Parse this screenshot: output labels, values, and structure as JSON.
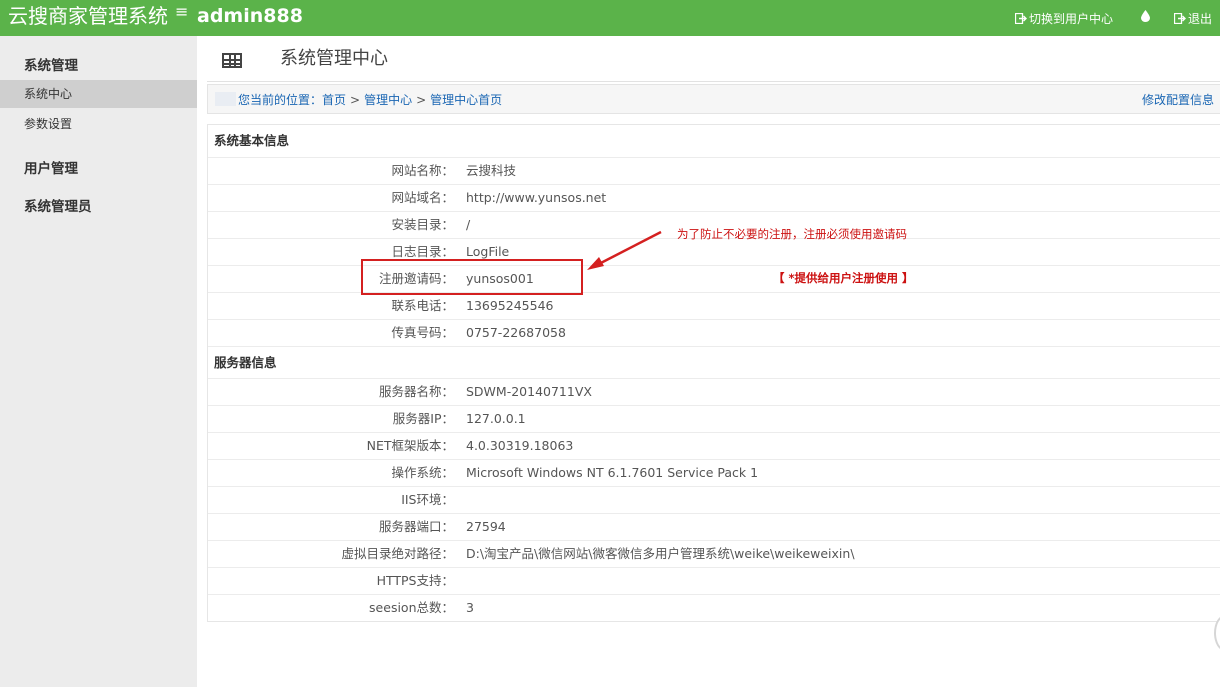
{
  "header": {
    "brand": "云搜商家管理系统",
    "menu_icon": "≡",
    "username": "admin888",
    "switch_label": "切换到用户中心",
    "logout_label": "退出"
  },
  "sidebar": {
    "groups": [
      {
        "label": "系统管理"
      },
      {
        "label": "用户管理"
      },
      {
        "label": "系统管理员"
      }
    ],
    "items": [
      {
        "label": "系统中心",
        "active": true
      },
      {
        "label": "参数设置",
        "active": false
      }
    ]
  },
  "page": {
    "title": "系统管理中心",
    "breadcrumb": {
      "prefix": "您当前的位置：",
      "items": [
        "首页",
        "管理中心",
        "管理中心首页"
      ],
      "separator": ">"
    },
    "config_link": "修改配置信息"
  },
  "basic_info": {
    "title": "系统基本信息",
    "rows": [
      {
        "key": "网站名称：",
        "value": "云搜科技"
      },
      {
        "key": "网站域名：",
        "value": "http://www.yunsos.net"
      },
      {
        "key": "安装目录：",
        "value": "/"
      },
      {
        "key": "日志目录：",
        "value": "LogFile"
      },
      {
        "key": "注册邀请码：",
        "value": "yunsos001"
      },
      {
        "key": "联系电话：",
        "value": "13695245546"
      },
      {
        "key": "传真号码：",
        "value": "0757-22687058"
      }
    ]
  },
  "server_info": {
    "title": "服务器信息",
    "rows": [
      {
        "key": "服务器名称：",
        "value": "SDWM-20140711VX"
      },
      {
        "key": "服务器IP：",
        "value": "127.0.0.1"
      },
      {
        "key": "NET框架版本：",
        "value": "4.0.30319.18063"
      },
      {
        "key": "操作系统：",
        "value": "Microsoft Windows NT 6.1.7601 Service Pack 1"
      },
      {
        "key": "IIS环境：",
        "value": ""
      },
      {
        "key": "服务器端口：",
        "value": "27594"
      },
      {
        "key": "虚拟目录绝对路径：",
        "value": "D:\\淘宝产品\\微信网站\\微客微信多用户管理系统\\weike\\weikeweixin\\"
      },
      {
        "key": "HTTPS支持：",
        "value": ""
      },
      {
        "key": "seesion总数：",
        "value": "3"
      }
    ]
  },
  "annotations": {
    "note": "为了防止不必要的注册，注册必须使用邀请码",
    "invite_note": "【 *提供给用户注册使用 】",
    "color": "#cc1111"
  },
  "colors": {
    "header_bg": "#5bb34a",
    "sidebar_bg": "#ececec",
    "link": "#1a66b3"
  }
}
